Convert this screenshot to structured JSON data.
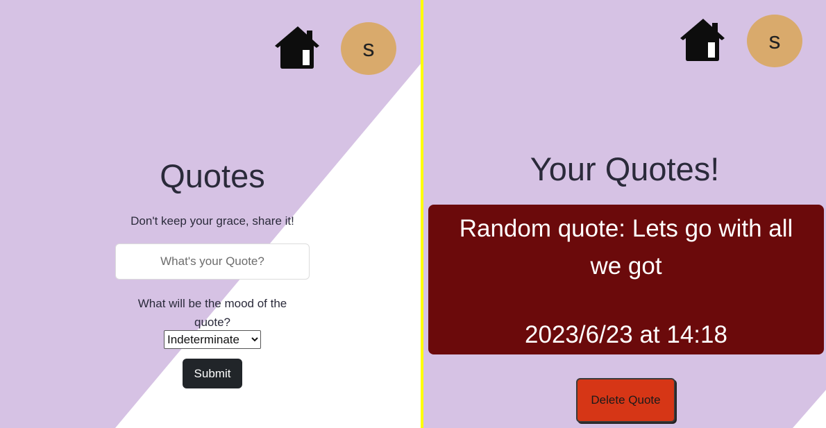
{
  "colors": {
    "lavender": "#d6c2e4",
    "divider": "#ffff00",
    "avatar": "#d9aa6c",
    "quote_card": "#6b0a0b",
    "submit_button": "#212529",
    "delete_button": "#d63616"
  },
  "left_page": {
    "header": {
      "home_icon": "home-icon",
      "avatar_letter": "s"
    },
    "title": "Quotes",
    "tagline": "Don't keep your grace, share it!",
    "quote_input": {
      "placeholder": "What's your Quote?",
      "value": ""
    },
    "mood_label": "What will be the mood of the quote?",
    "mood_select": {
      "selected": "Indeterminate"
    },
    "submit_label": "Submit"
  },
  "right_page": {
    "header": {
      "home_icon": "home-icon",
      "avatar_letter": "s"
    },
    "title": "Your Quotes!",
    "quote": {
      "text": "Random quote: Lets go with all we got",
      "date": "2023/6/23 at 14:18"
    },
    "delete_label": "Delete Quote"
  }
}
